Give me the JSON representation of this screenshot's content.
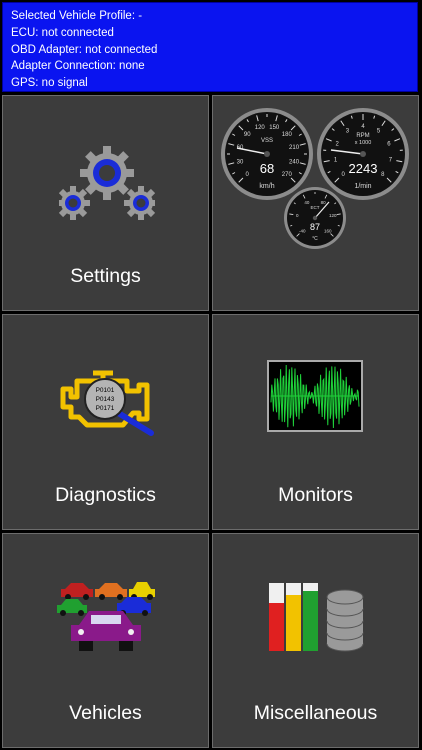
{
  "status": {
    "vehicle_profile": "Selected Vehicle Profile: -",
    "ecu": "ECU: not connected",
    "obd_adapter": "OBD Adapter: not connected",
    "adapter_connection": "Adapter Connection: none",
    "gps": "GPS: no signal"
  },
  "tiles": {
    "settings": {
      "label": "Settings",
      "icon": "gears-icon"
    },
    "gauges": {
      "icon": "gauges-icon",
      "vss": {
        "name": "VSS",
        "value": "68",
        "unit": "km/h",
        "ticks": [
          "0",
          "30",
          "60",
          "90",
          "120",
          "150",
          "180",
          "210",
          "240",
          "270"
        ]
      },
      "rpm": {
        "name": "RPM",
        "multiplier": "x 1000",
        "value": "2243",
        "unit": "1/min",
        "ticks": [
          "0",
          "1",
          "2",
          "3",
          "4",
          "5",
          "6",
          "7",
          "8"
        ]
      },
      "ect": {
        "name": "ECT",
        "value": "87",
        "unit": "°C",
        "ticks": [
          "-40",
          "0",
          "40",
          "80",
          "120",
          "160"
        ]
      }
    },
    "diagnostics": {
      "label": "Diagnostics",
      "icon": "engine-check-icon",
      "codes": [
        "P0101",
        "P0143",
        "P0171"
      ]
    },
    "monitors": {
      "label": "Monitors",
      "icon": "oscilloscope-icon"
    },
    "vehicles": {
      "label": "Vehicles",
      "icon": "cars-icon"
    },
    "miscellaneous": {
      "label": "Miscellaneous",
      "icon": "database-icon"
    }
  },
  "colors": {
    "status_bg": "#0a14f0",
    "tile_bg": "#3c3c3c",
    "gear_blue": "#1a2cd8",
    "engine_yellow": "#f2c200",
    "wave_green": "#1fd23a"
  }
}
